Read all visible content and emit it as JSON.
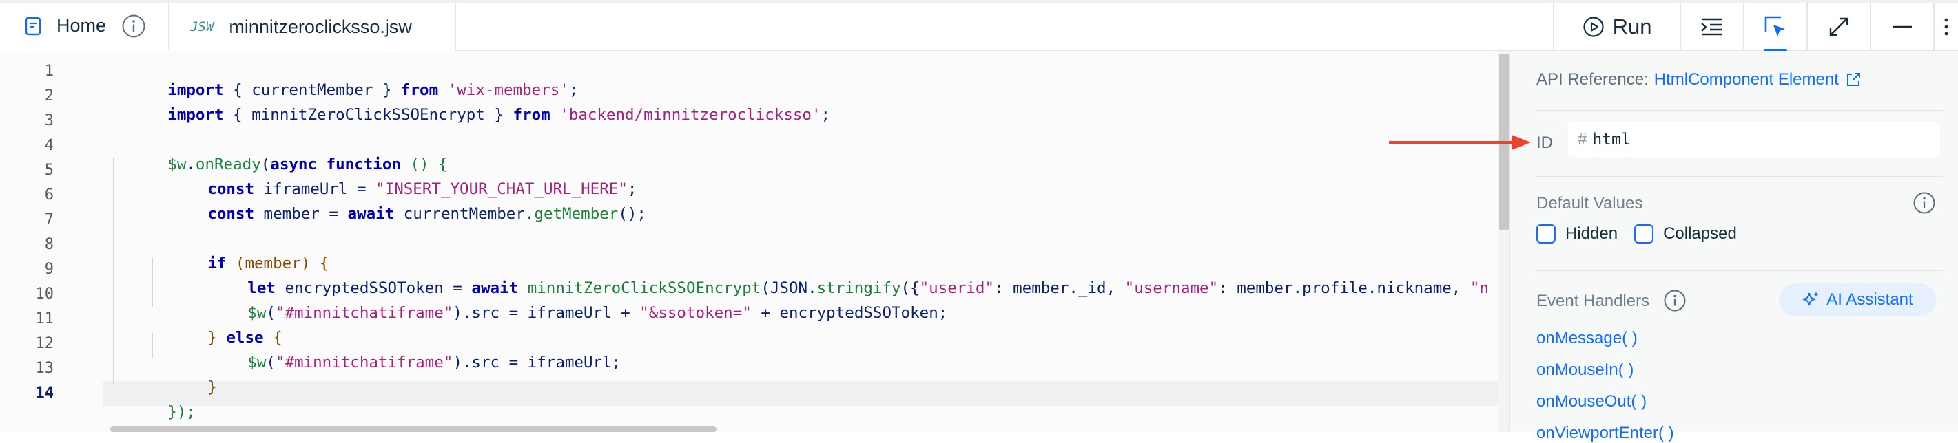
{
  "tabs": {
    "home_label": "Home",
    "file_badge": "JSW",
    "file_label": "minnitzeroclicksso.jsw"
  },
  "toolbar": {
    "run_label": "Run"
  },
  "editor": {
    "line_numbers": [
      "1",
      "2",
      "3",
      "4",
      "5",
      "6",
      "7",
      "8",
      "9",
      "10",
      "11",
      "12",
      "13",
      "14"
    ],
    "active_line": "14",
    "lines": {
      "l1": [
        "import",
        " { ",
        "currentMember",
        " } ",
        "from",
        " ",
        "'wix-members'",
        ";"
      ],
      "l2": [
        "import",
        " { ",
        "minnitZeroClickSSOEncrypt",
        " } ",
        "from",
        " ",
        "'backend/minnitzeroclicksso'",
        ";"
      ],
      "l4": [
        "$w",
        ".",
        "onReady",
        "(",
        "async",
        " ",
        "function",
        " () {"
      ],
      "l5": [
        "const",
        " iframeUrl = ",
        "\"INSERT_YOUR_CHAT_URL_HERE\"",
        ";"
      ],
      "l6": [
        "const",
        " member = ",
        "await",
        " currentMember.",
        "getMember",
        "();"
      ],
      "l8": [
        "if",
        " (member) {"
      ],
      "l9": [
        "let",
        " encryptedSSOToken = ",
        "await",
        " ",
        "minnitZeroClickSSOEncrypt",
        "(JSON.",
        "stringify",
        "({",
        "\"userid\"",
        ": member._id, ",
        "\"username\"",
        ": member.profile.nickname, ",
        "\"n"
      ],
      "l10": [
        "$w",
        "(",
        "\"#minnitchatiframe\"",
        ").src = iframeUrl + ",
        "\"&ssotoken=\"",
        " + encryptedSSOToken;"
      ],
      "l11": [
        "} ",
        "else",
        " {"
      ],
      "l12": [
        "$w",
        "(",
        "\"#minnitchatiframe\"",
        ").src = iframeUrl;"
      ],
      "l13": [
        "}"
      ],
      "l14": [
        "});"
      ]
    }
  },
  "panel": {
    "api_prefix": "API Reference:",
    "api_link": "HtmlComponent Element",
    "id_label": "ID",
    "id_hash": "#",
    "id_value": "html",
    "default_values_title": "Default Values",
    "hidden_label": "Hidden",
    "collapsed_label": "Collapsed",
    "event_handlers_title": "Event Handlers",
    "ai_assistant_label": "AI Assistant",
    "handlers": [
      "onMessage( )",
      "onMouseIn( )",
      "onMouseOut( )",
      "onViewportEnter( )"
    ]
  },
  "colors": {
    "accent": "#116dff",
    "arrow": "#e8452c",
    "keyword": "#0000b0",
    "string": "#a3217d",
    "function": "#1d7f3c"
  }
}
